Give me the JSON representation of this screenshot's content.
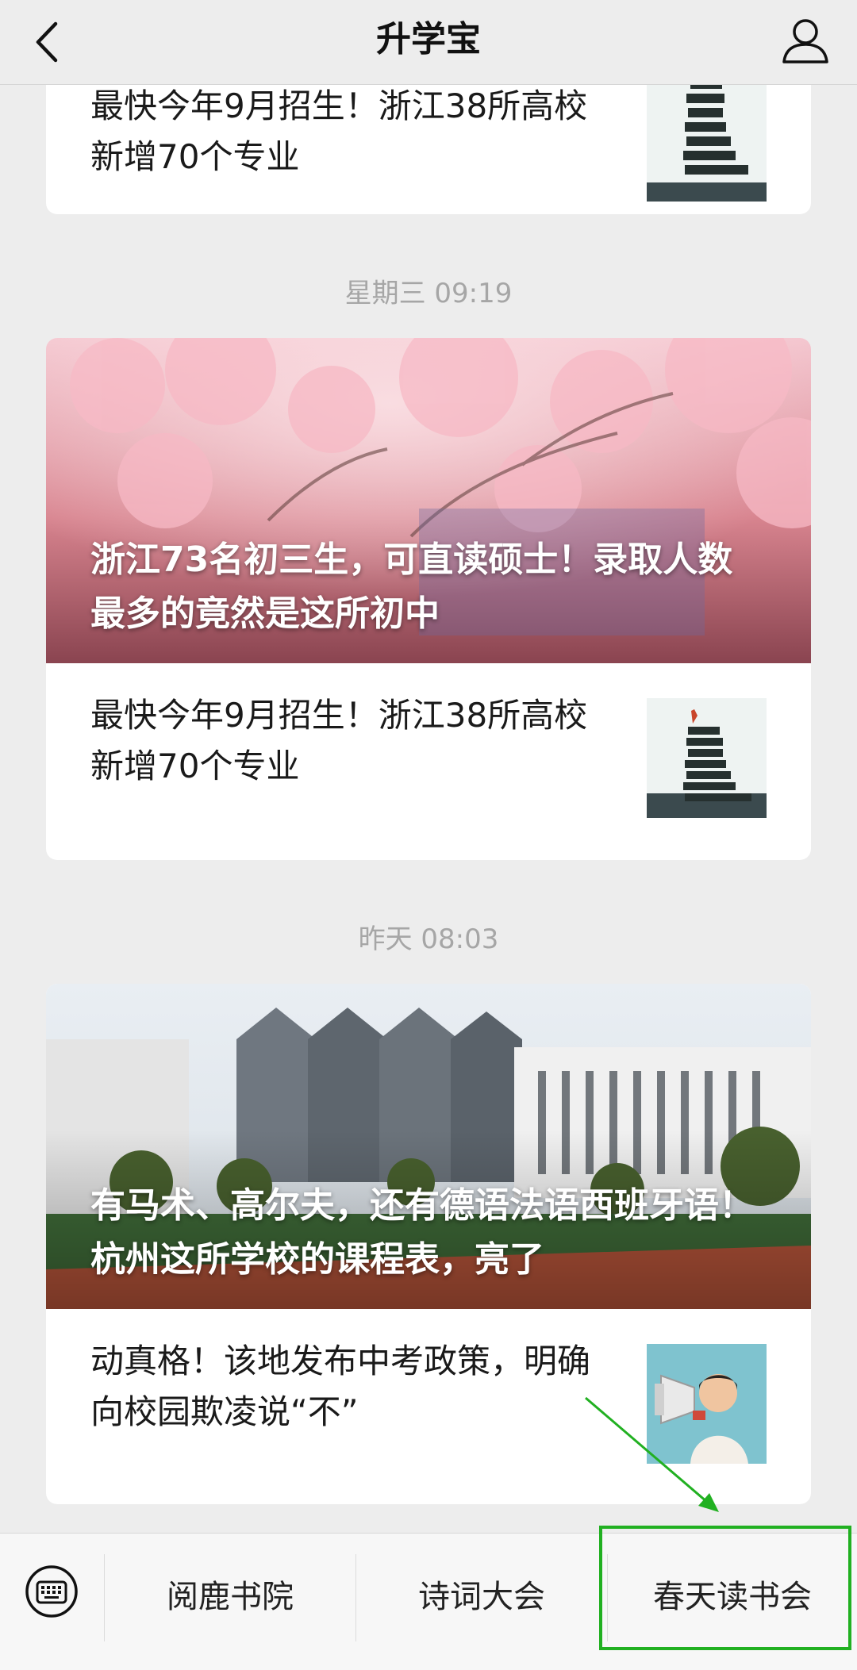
{
  "header": {
    "title": "升学宝"
  },
  "feed": {
    "partial_card": {
      "text": "最快今年9月招生！浙江38所高校新增70个专业"
    },
    "group1": {
      "timestamp": "星期三 09:19",
      "hero_title": "浙江73名初三生，可直读硕士！录取人数最多的竟然是这所初中",
      "item_text": "最快今年9月招生！浙江38所高校新增70个专业"
    },
    "group2": {
      "timestamp": "昨天 08:03",
      "hero_title": "有马术、高尔夫，还有德语法语西班牙语！杭州这所学校的课程表，亮了",
      "item_text": "动真格！该地发布中考政策，明确向校园欺凌说“不”"
    }
  },
  "bottom_menu": {
    "items": [
      "阅鹿书院",
      "诗词大会",
      "春天读书会"
    ],
    "highlight_color": "#21b021"
  }
}
